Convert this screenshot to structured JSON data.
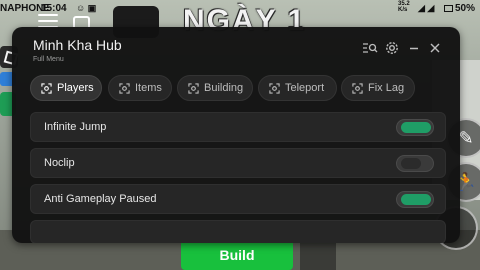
{
  "statusbar": {
    "carrier": "NAPHONE",
    "time": "15:04",
    "netspeed_value": "35.2",
    "netspeed_unit": "K/s",
    "battery": "50%"
  },
  "game": {
    "day_text": "NGÀY 1",
    "build_label": "Build"
  },
  "hub": {
    "title": "Minh Kha Hub",
    "subtitle": "Full Menu",
    "tabs": [
      {
        "label": "Players",
        "active": true
      },
      {
        "label": "Items",
        "active": false
      },
      {
        "label": "Building",
        "active": false
      },
      {
        "label": "Teleport",
        "active": false
      },
      {
        "label": "Fix Lag",
        "active": false
      }
    ],
    "rows": [
      {
        "label": "Infinite Jump",
        "enabled": true
      },
      {
        "label": "Noclip",
        "enabled": false
      },
      {
        "label": "Anti Gameplay Paused",
        "enabled": true
      }
    ]
  },
  "icons": {
    "search": "search-list-icon",
    "settings": "gear-icon",
    "minimize": "minus-icon",
    "close": "close-icon"
  },
  "colors": {
    "accent_on": "#1f9d66",
    "build_green": "#18c03d",
    "panel_bg": "#121212"
  }
}
